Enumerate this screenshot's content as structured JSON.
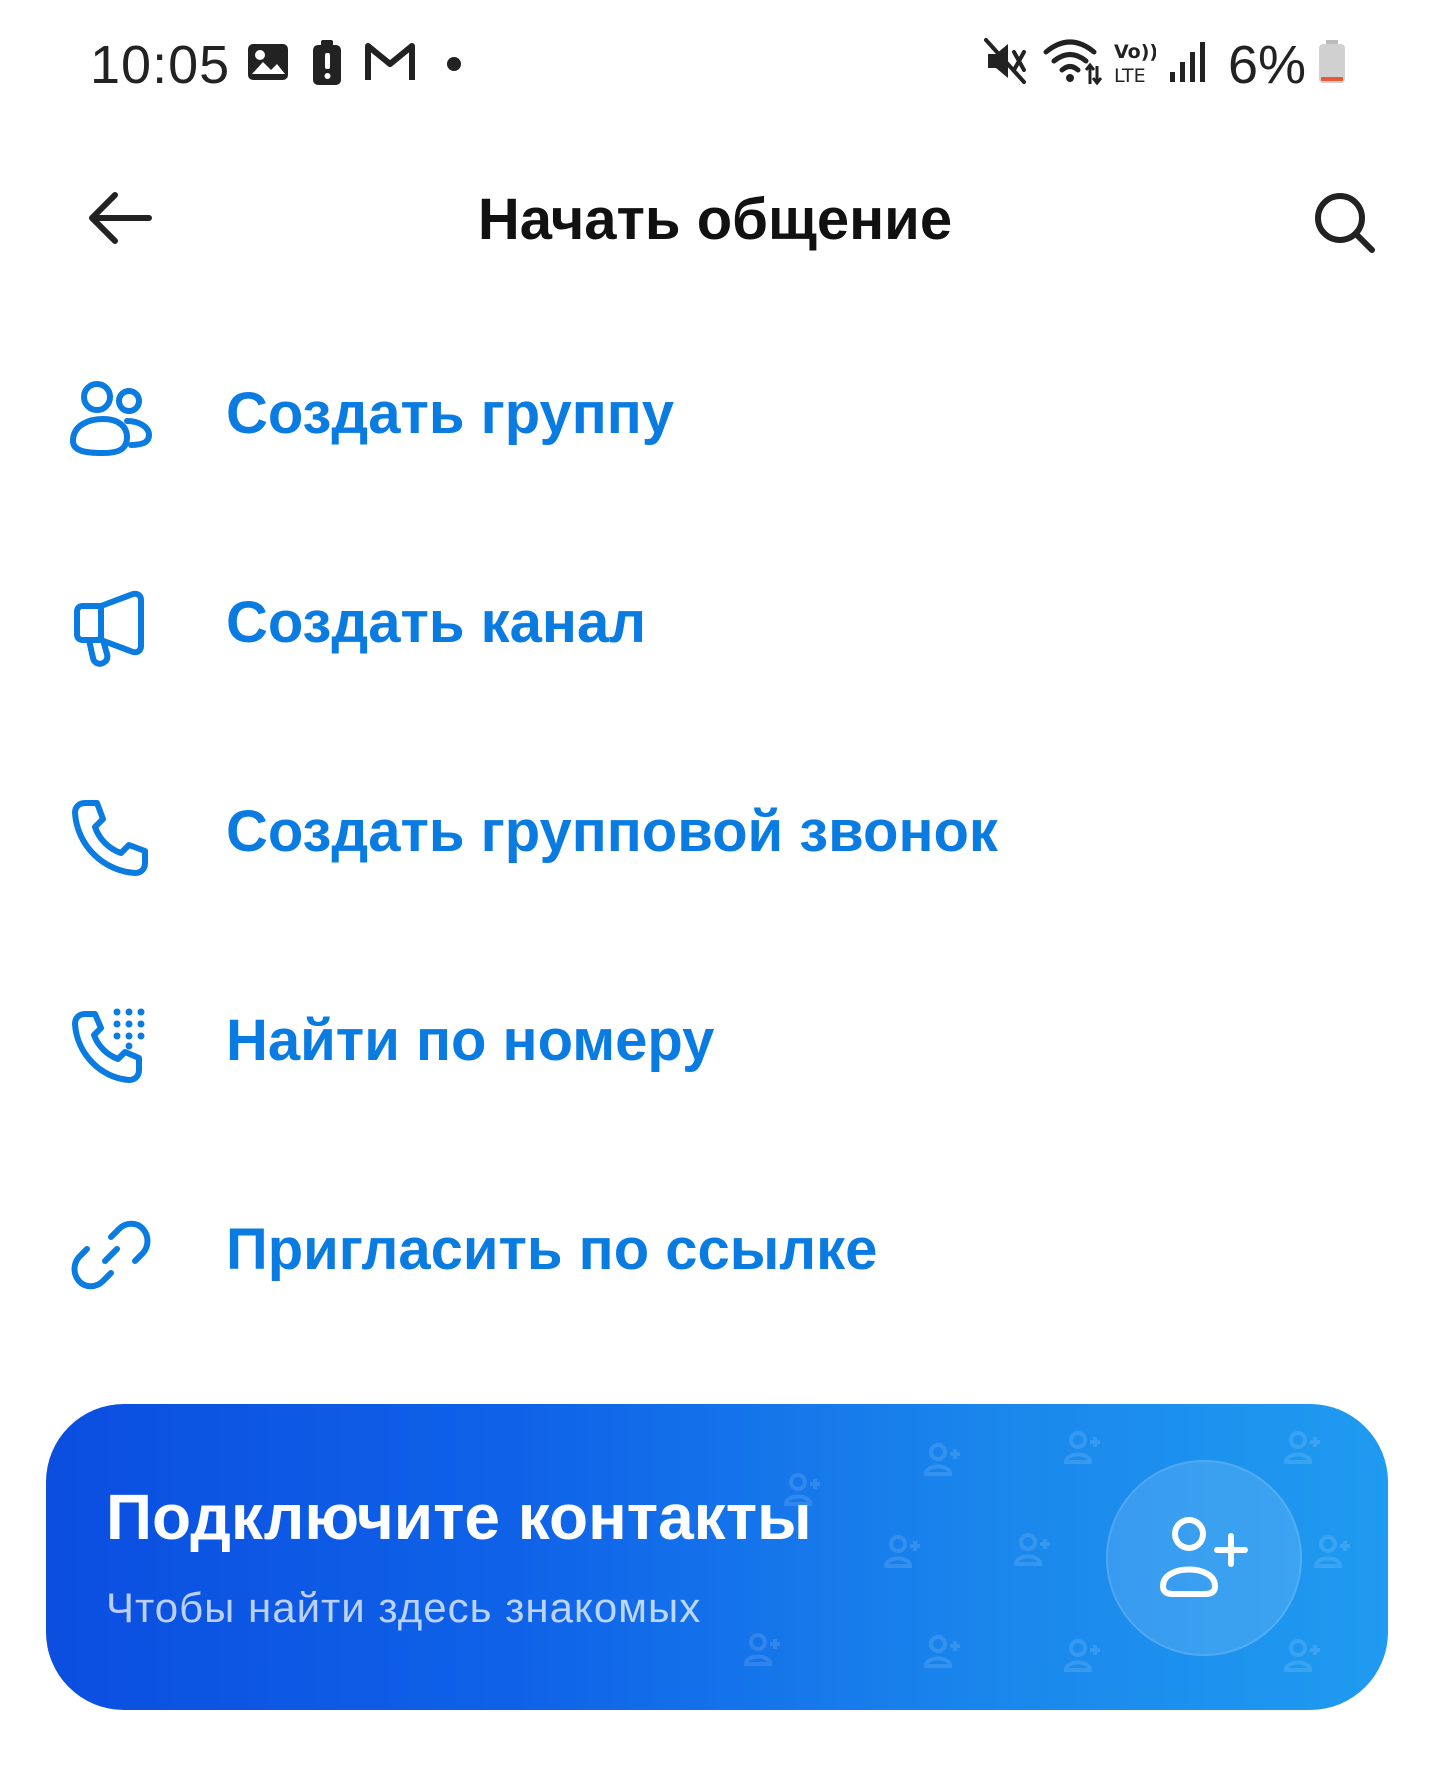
{
  "status_bar": {
    "time": "10:05",
    "battery_percent": "6%",
    "left_icons": [
      "gallery-icon",
      "battery-alert-icon",
      "gmail-icon",
      "notification-dot-icon"
    ],
    "right_icons": [
      "vibrate-mute-icon",
      "wifi-icon",
      "volte-icon",
      "signal-icon",
      "battery-low-icon"
    ]
  },
  "header": {
    "title": "Начать общение",
    "back_icon": "arrow-left-icon",
    "search_icon": "search-icon"
  },
  "menu": {
    "items": [
      {
        "label": "Создать группу",
        "icon": "group-icon"
      },
      {
        "label": "Создать канал",
        "icon": "megaphone-icon"
      },
      {
        "label": "Создать групповой звонок",
        "icon": "phone-icon"
      },
      {
        "label": "Найти по номеру",
        "icon": "dialpad-phone-icon"
      },
      {
        "label": "Пригласить по ссылке",
        "icon": "link-icon"
      }
    ]
  },
  "banner": {
    "title": "Подключите контакты",
    "subtitle": "Чтобы найти здесь знакомых",
    "action_icon": "add-contact-icon"
  },
  "colors": {
    "accent": "#0a7be0",
    "title_text": "#111111",
    "banner_gradient_start": "#0b4ee0",
    "banner_gradient_end": "#1f9bf0"
  }
}
